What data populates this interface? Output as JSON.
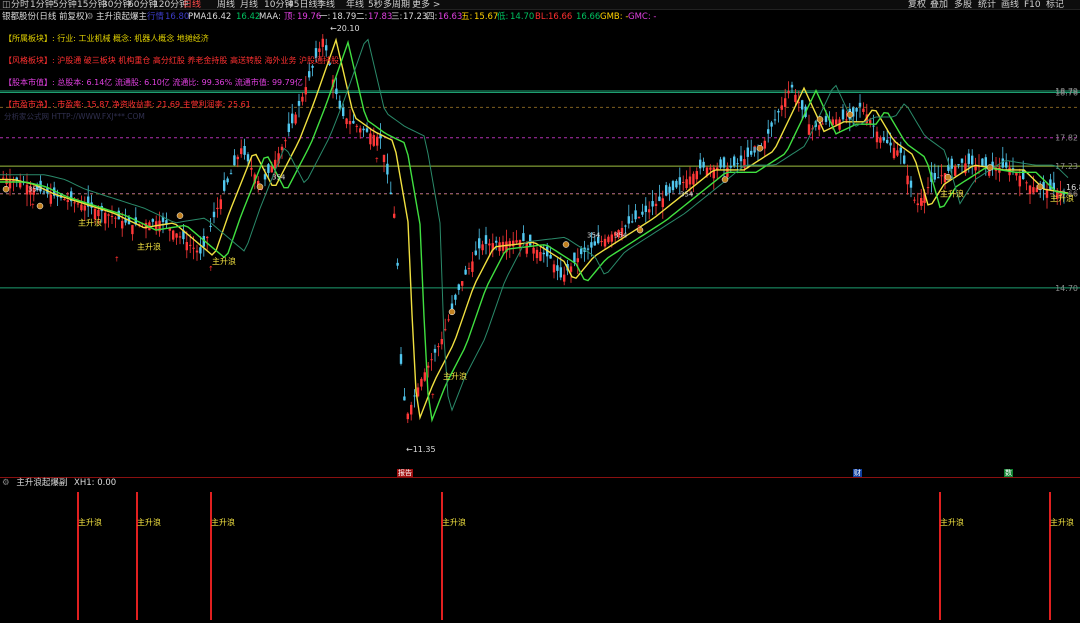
{
  "topbar": {
    "icon": "grid-icon",
    "periods": [
      "分时",
      "1分钟",
      "5分钟",
      "15分钟",
      "30分钟",
      "60分钟",
      "120分钟",
      "日线",
      "周线",
      "月线",
      "10分钟",
      "45日线",
      "季线",
      "年线",
      "5秒",
      "多周期",
      "更多 >"
    ],
    "active_period": "日线",
    "right_buttons": [
      "复权",
      "叠加",
      "多股",
      "统计",
      "画线",
      "F10",
      "标记"
    ]
  },
  "info": {
    "stock": "银都股份(日线 前复权)",
    "indicator": "主升浪起爆主",
    "price_label": "行情",
    "price_value": "16.80",
    "pma_label": "PMA:",
    "pma_value": "16.42",
    "pma2": "16.42",
    "maa_label": "MAA:",
    "top_label": "顶:",
    "top_value": "19.76",
    "one_label": "一:",
    "one_value": "18.79",
    "two_label": "二:",
    "two_value": "17.83",
    "three_label": "三:",
    "three_value": "17.23",
    "four_label": "四:",
    "four_value": "16.63",
    "five_label": "五:",
    "five_value": "15.67",
    "low_label": "低:",
    "low_value": "14.70",
    "bl_label": "BL:",
    "bl_value": "16.66",
    "bl2": "16.66",
    "gmb": "GMB: -",
    "gmc": "GMC: -"
  },
  "annotations": [
    {
      "tag": "【所属板块】:",
      "text": "行业: 工业机械 概念: 机器人概念 地摊经济",
      "tag_color": "#e0d000",
      "text_color": "#e0d000"
    },
    {
      "tag": "【风格板块】:",
      "text": "沪股通 破三板块 机构重仓 高分红股 养老金持股 高送转股 海外业务 沪股通持股",
      "tag_color": "#ff3030",
      "text_color": "#ff3030"
    },
    {
      "tag": "【股本市值】:",
      "text": "总股本: 6.14亿 流通股: 6.10亿 流通比: 99.36% 流通市值: 99.79亿",
      "tag_color": "#e040e0",
      "text_color": "#e040e0"
    },
    {
      "tag": "【市盈市净】:",
      "text": "市盈率: 15.87 净资收益率: 21.69 主营利润率: 25.61",
      "tag_color": "#ff3030",
      "text_color": "#ff3030"
    }
  ],
  "watermark": "分析家公式网 HTTP://WWW.FXJ***.COM",
  "chart_data": {
    "type": "candlestick",
    "title": "银都股份(日线 前复权)",
    "price_levels": [
      18.76,
      18.79,
      17.82,
      17.23,
      16.66,
      14.7
    ],
    "axis_labels": [
      "18.76",
      "18.79",
      "17.82",
      "17.23",
      "16.66",
      "14.70"
    ],
    "y_range": [
      11.0,
      20.5
    ],
    "high_label": "20.10",
    "low_label": "11.35",
    "current_label": "16.8",
    "signals": [
      "主升浪",
      "主升浪",
      "主升浪",
      "主升浪",
      "主升浪",
      "主升浪"
    ],
    "markers": [
      "354",
      "354",
      "354",
      "354",
      "354"
    ]
  },
  "sub_panel": {
    "title": "主升浪起爆副",
    "xh1": "XH1: 0.00",
    "signal_label": "主升浪"
  },
  "timeline_badges": [
    "报告",
    "财",
    "数"
  ]
}
